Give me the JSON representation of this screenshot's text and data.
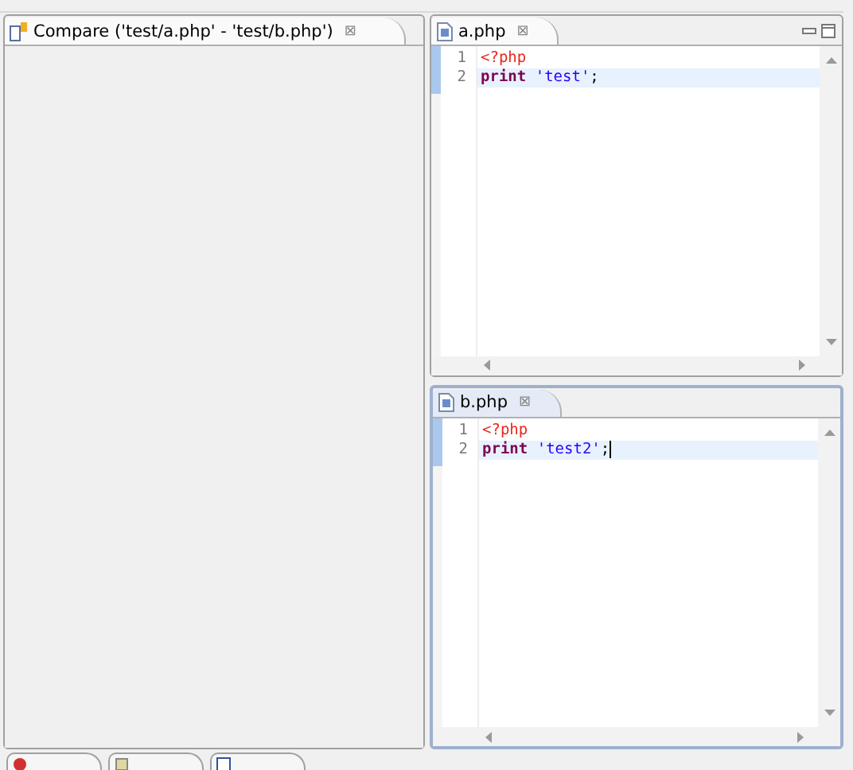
{
  "compare_editor": {
    "tab_title": "Compare ('test/a.php' - 'test/b.php')",
    "close": "⊠"
  },
  "editors": [
    {
      "tab_title": "a.php",
      "close": "⊠",
      "active": false,
      "show_window_controls": true,
      "lines": [
        {
          "number": "1",
          "highlighted": false,
          "caret": false,
          "tokens": [
            {
              "kind": "tag",
              "text": "<?php"
            }
          ]
        },
        {
          "number": "2",
          "highlighted": true,
          "caret": false,
          "tokens": [
            {
              "kind": "keyword",
              "text": "print"
            },
            {
              "kind": "string",
              "text": "'test'"
            },
            {
              "kind": "plain",
              "text": ";"
            }
          ]
        }
      ]
    },
    {
      "tab_title": "b.php",
      "close": "⊠",
      "active": true,
      "show_window_controls": false,
      "lines": [
        {
          "number": "1",
          "highlighted": false,
          "caret": false,
          "tokens": [
            {
              "kind": "tag",
              "text": "<?php"
            }
          ]
        },
        {
          "number": "2",
          "highlighted": true,
          "caret": true,
          "tokens": [
            {
              "kind": "keyword",
              "text": "print"
            },
            {
              "kind": "string",
              "text": "'test2'"
            },
            {
              "kind": "plain",
              "text": ";"
            }
          ]
        }
      ]
    }
  ]
}
